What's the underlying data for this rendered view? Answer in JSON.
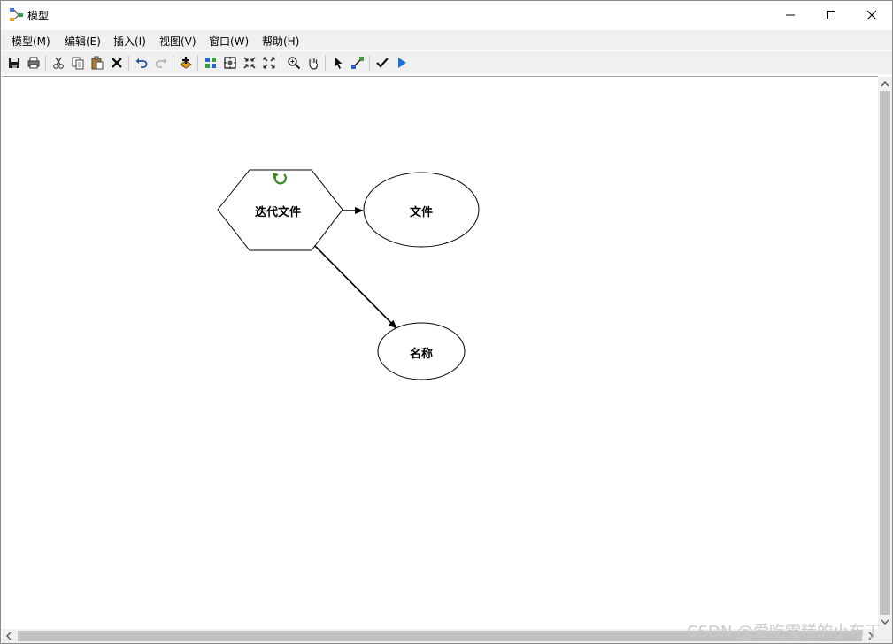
{
  "window": {
    "title": "模型"
  },
  "menu": {
    "items": [
      "模型(M)",
      "编辑(E)",
      "插入(I)",
      "视图(V)",
      "窗口(W)",
      "帮助(H)"
    ]
  },
  "toolbar": {
    "buttons": [
      "save-icon",
      "print-icon",
      "cut-icon",
      "copy-icon",
      "paste-icon",
      "delete-icon",
      "undo-icon",
      "redo-icon",
      "add-data-icon",
      "auto-layout-icon",
      "full-extent-icon",
      "fixed-zoom-in-icon",
      "fixed-zoom-out-icon",
      "zoom-in-icon",
      "pan-icon",
      "select-icon",
      "connect-icon",
      "validate-icon",
      "run-icon"
    ]
  },
  "diagram": {
    "nodes": [
      {
        "id": "iterator",
        "label": "迭代文件",
        "shape": "hexagon"
      },
      {
        "id": "file",
        "label": "文件",
        "shape": "ellipse"
      },
      {
        "id": "name",
        "label": "名称",
        "shape": "ellipse"
      }
    ],
    "edges": [
      {
        "from": "iterator",
        "to": "file"
      },
      {
        "from": "iterator",
        "to": "name"
      }
    ]
  },
  "watermark": "CSDN @爱吃雪糕的小布丁",
  "colors": {
    "iterate_icon": "#3a8a1f",
    "run_icon": "#1d6fd1",
    "add_data_icon": "#d48a00"
  }
}
